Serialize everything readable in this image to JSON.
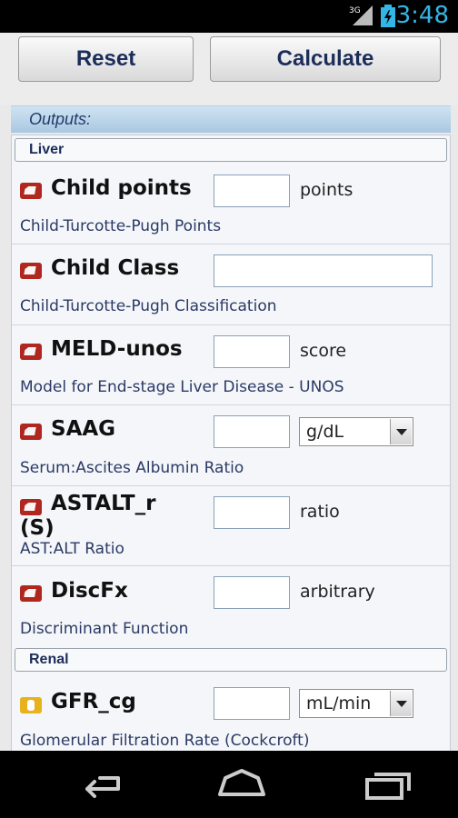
{
  "status_bar": {
    "signal_label": "3G",
    "time": "3:48"
  },
  "buttons": {
    "reset": "Reset",
    "calculate": "Calculate"
  },
  "outputs_header": "Outputs:",
  "sections": [
    {
      "title": "Liver",
      "rows": [
        {
          "label": "Child points",
          "description": "Child-Turcotte-Pugh Points",
          "value": "",
          "unit": "points",
          "icon": "formula-icon",
          "icon_color": "#b0271f"
        },
        {
          "label": "Child Class",
          "description": "Child-Turcotte-Pugh Classification",
          "value": "",
          "unit": "",
          "icon": "formula-icon",
          "icon_color": "#b0271f"
        },
        {
          "label": "MELD-unos",
          "description": "Model for End-stage Liver Disease - UNOS",
          "value": "",
          "unit": "score",
          "icon": "formula-icon",
          "icon_color": "#b0271f"
        },
        {
          "label": "SAAG",
          "description": "Serum:Ascites Albumin Ratio",
          "value": "",
          "unit_select": "g/dL",
          "icon": "formula-icon",
          "icon_color": "#b0271f"
        },
        {
          "label": "ASTALT_r",
          "label_line2": "(S)",
          "description": "AST:ALT Ratio",
          "value": "",
          "unit": "ratio",
          "icon": "formula-icon",
          "icon_color": "#b0271f"
        },
        {
          "label": "DiscFx",
          "description": "Discriminant Function",
          "value": "",
          "unit": "arbitrary",
          "icon": "formula-icon",
          "icon_color": "#b0271f"
        }
      ]
    },
    {
      "title": "Renal",
      "rows": [
        {
          "label": "GFR_cg",
          "description": "Glomerular Filtration Rate (Cockcroft)",
          "value": "",
          "unit_select": "mL/min",
          "icon": "kidney-icon",
          "icon_color": "#e7b21b"
        }
      ]
    }
  ],
  "nav_bar": {
    "back_icon": "back-icon",
    "home_icon": "home-icon",
    "recent_icon": "recent-apps-icon"
  }
}
